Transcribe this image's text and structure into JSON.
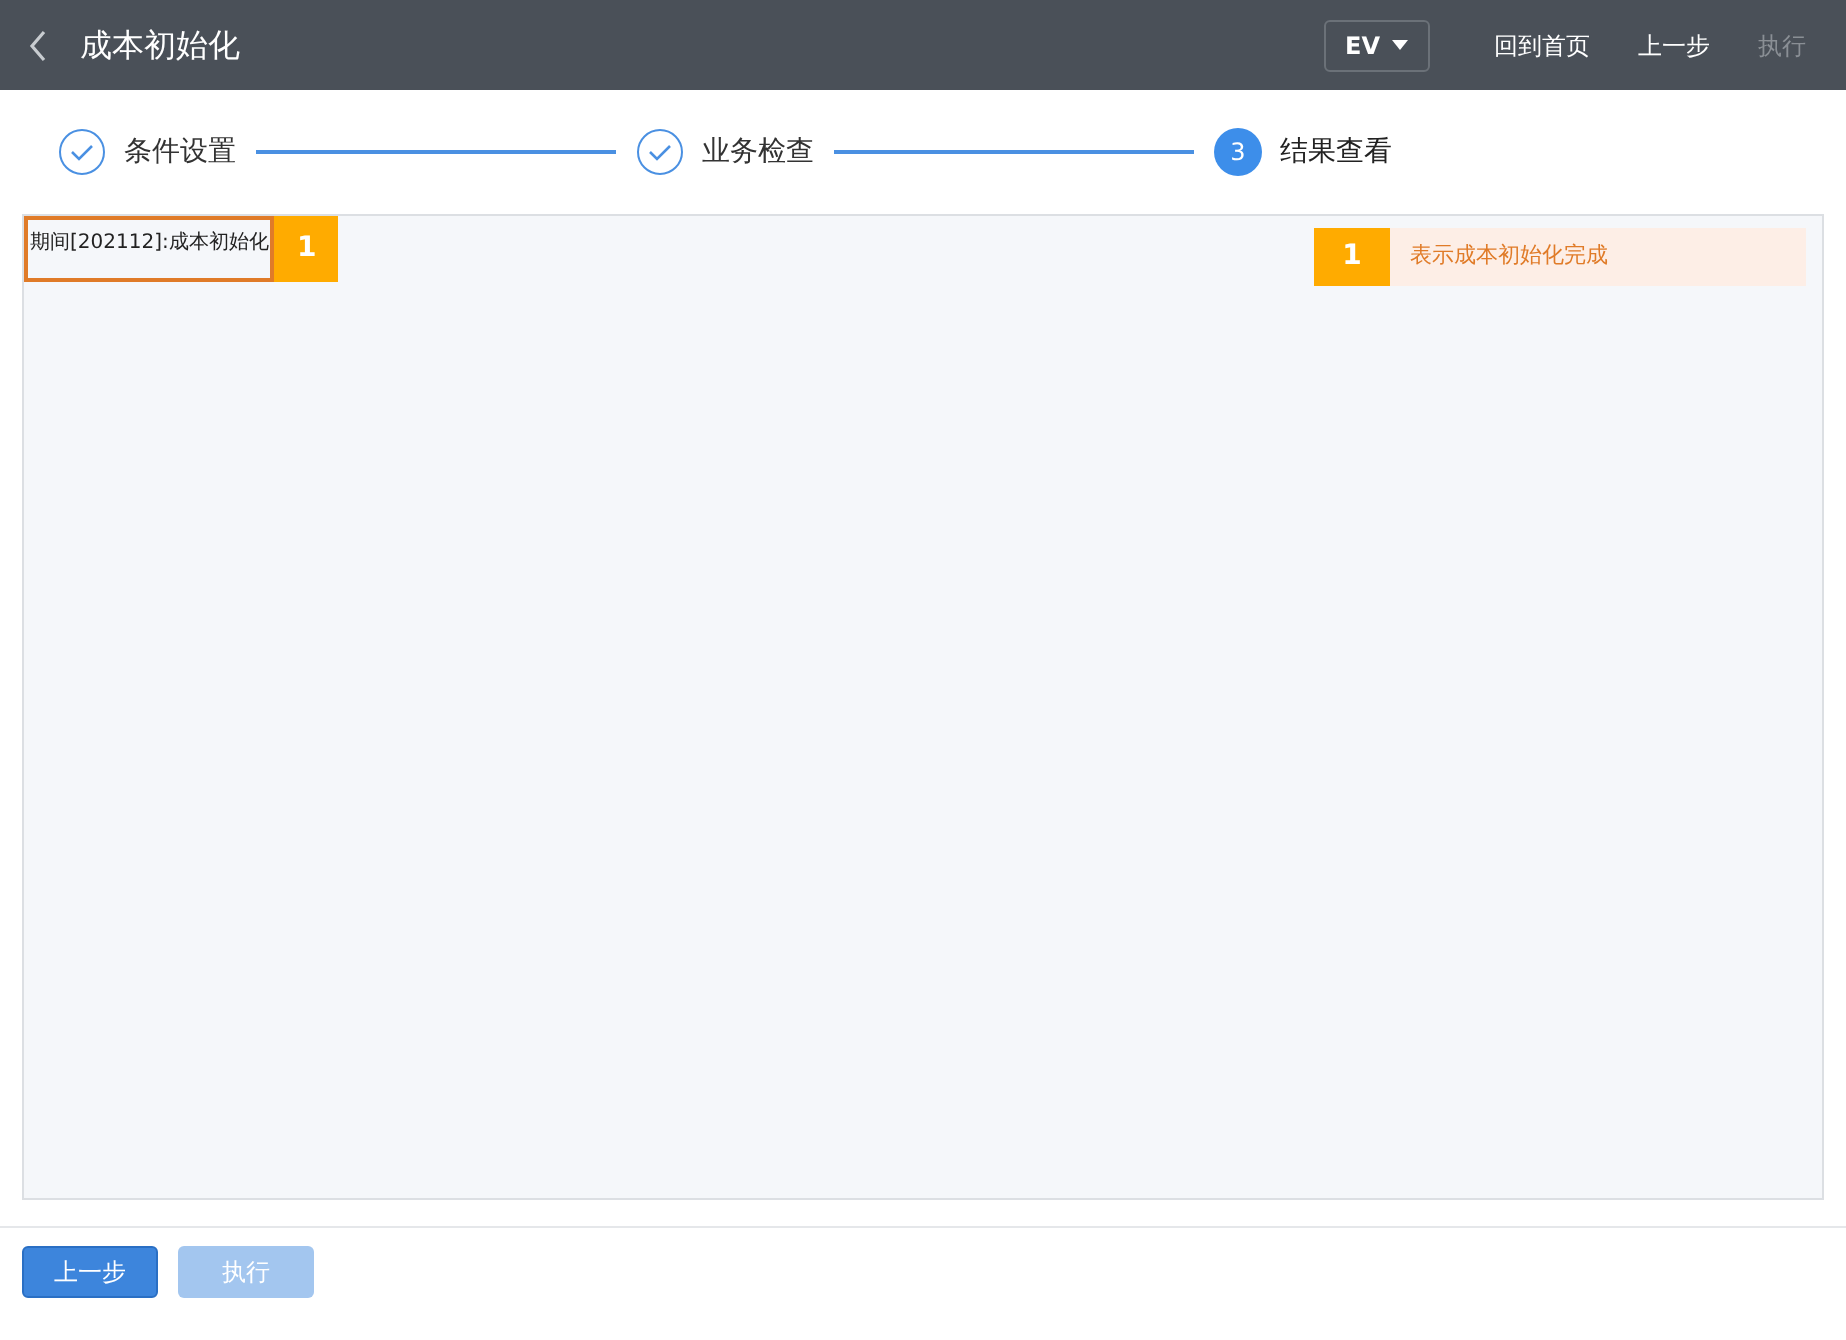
{
  "header": {
    "title": "成本初始化",
    "selector": "EV",
    "actions": [
      {
        "label": "回到首页",
        "disabled": false
      },
      {
        "label": "上一步",
        "disabled": false
      },
      {
        "label": "执行",
        "disabled": true
      }
    ]
  },
  "steps": [
    {
      "label": "条件设置",
      "completed": true,
      "selected": false
    },
    {
      "label": "业务检查",
      "completed": true,
      "selected": false
    },
    {
      "label": "结果查看",
      "number": "3",
      "completed": false,
      "selected": true
    }
  ],
  "result": {
    "item": "期间[202112]:成本初始化",
    "badge": "1",
    "legend": {
      "badge": "1",
      "text": "表示成本初始化完成"
    }
  },
  "footer": {
    "buttons": [
      {
        "label": "上一步",
        "disabled": false
      },
      {
        "label": "执行",
        "disabled": true
      }
    ]
  }
}
